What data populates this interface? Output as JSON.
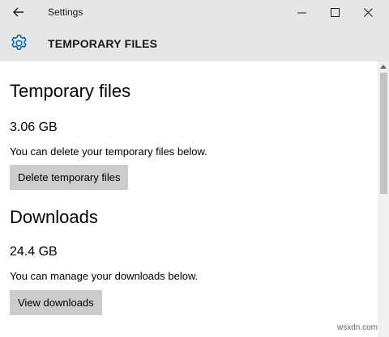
{
  "window": {
    "title": "Settings"
  },
  "header": {
    "title": "TEMPORARY FILES"
  },
  "sections": {
    "temp": {
      "heading": "Temporary files",
      "size": "3.06 GB",
      "description": "You can delete your temporary files below.",
      "button_label": "Delete temporary files"
    },
    "downloads": {
      "heading": "Downloads",
      "size": "24.4 GB",
      "description": "You can manage your downloads below.",
      "button_label": "View downloads"
    }
  },
  "watermark": "wsxdn.com",
  "icons": {
    "back": "back-arrow-icon",
    "minimize": "minimize-icon",
    "maximize": "maximize-icon",
    "close": "close-icon",
    "settings": "gear-icon"
  },
  "colors": {
    "accent": "#0063b1",
    "chrome": "#e6e6e6",
    "button": "#cccccc"
  }
}
